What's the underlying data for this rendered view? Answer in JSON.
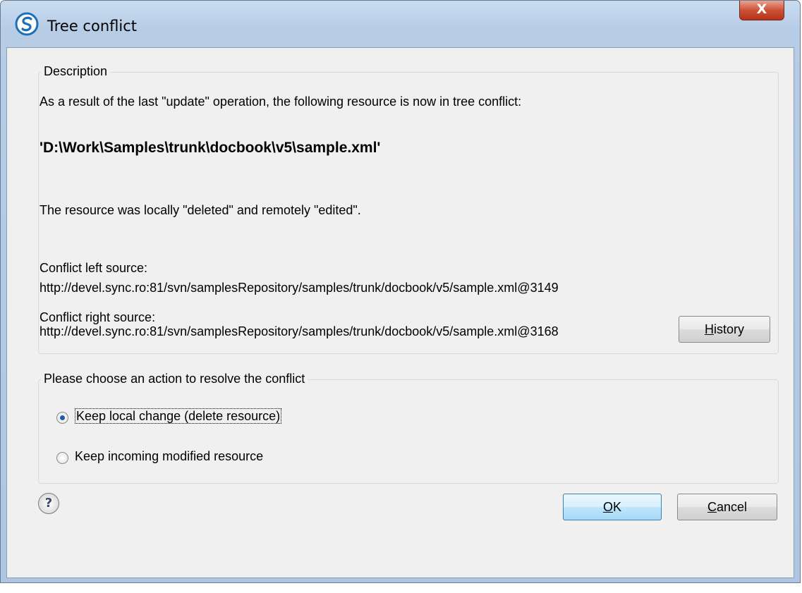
{
  "window": {
    "title": "Tree conflict",
    "close_label": "X"
  },
  "description": {
    "legend": "Description",
    "intro": "As a result of the last \"update\" operation, the following resource is now in tree conflict:",
    "resource_path": "'D:\\Work\\Samples\\trunk\\docbook\\v5\\sample.xml'",
    "conflict_reason": "The resource was locally \"deleted\" and remotely \"edited\".",
    "left_source_label": "Conflict left source:",
    "left_source_url": "http://devel.sync.ro:81/svn/samplesRepository/samples/trunk/docbook/v5/sample.xml@3149",
    "right_source_label": "Conflict right source:",
    "right_source_url": "http://devel.sync.ro:81/svn/samplesRepository/samples/trunk/docbook/v5/sample.xml@3168",
    "history_button": "History"
  },
  "action": {
    "legend": "Please choose an action to resolve the conflict",
    "options": [
      {
        "label": "Keep local change (delete resource)",
        "selected": true
      },
      {
        "label": "Keep incoming modified resource",
        "selected": false
      }
    ]
  },
  "footer": {
    "help_icon": "help-icon",
    "ok_button": "OK",
    "cancel_button": "Cancel"
  },
  "colors": {
    "dialog_background": "#f0f0f0",
    "titlebar": "#b7cde6",
    "close_button": "#cc5236",
    "default_button": "#bee6fd",
    "radio_selected": "#1d5fa7"
  }
}
